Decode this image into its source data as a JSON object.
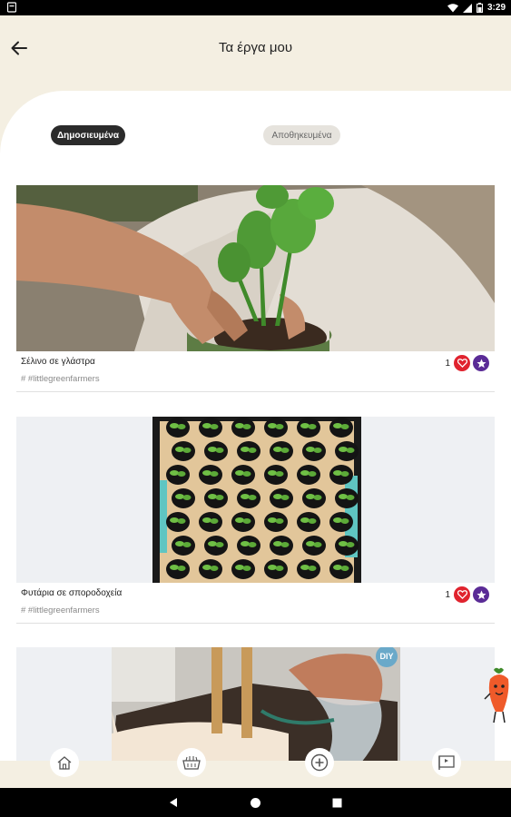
{
  "status_bar": {
    "time": "3:29"
  },
  "header": {
    "title": "Τα έργα μου"
  },
  "tabs": {
    "published": "Δημοσιευμένα",
    "saved": "Αποθηκευμένα"
  },
  "projects": [
    {
      "title": "Σέλινο σε γλάστρα",
      "tags": "# #littlegreenfarmers",
      "likes": "1"
    },
    {
      "title": "Φυτάρια σε σποροδοχεία",
      "tags": "# #littlegreenfarmers",
      "likes": "1"
    },
    {
      "badge": "DIY"
    }
  ],
  "colors": {
    "accent_red": "#e0232e",
    "accent_purple": "#5a2b96",
    "background": "#f4efe2"
  },
  "icons": {
    "back": "arrow-left-icon",
    "like": "heart-icon",
    "favorite": "star-icon",
    "nav": [
      "home-icon",
      "basket-icon",
      "add-circle-icon",
      "flag-board-icon"
    ]
  }
}
